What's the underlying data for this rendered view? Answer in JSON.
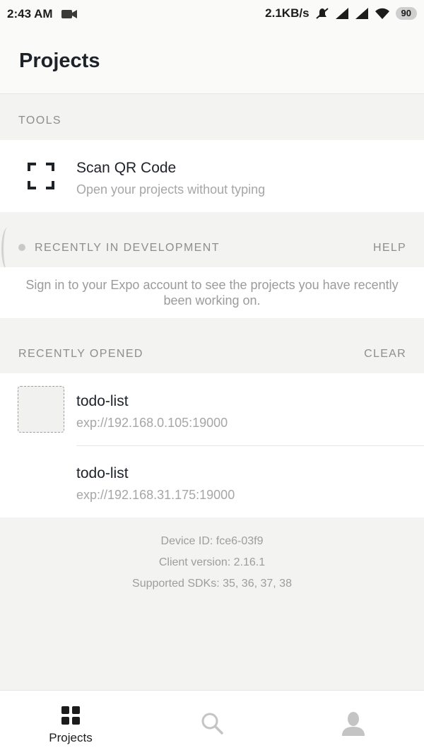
{
  "status_bar": {
    "time": "2:43 AM",
    "network_speed": "2.1KB/s",
    "battery": "90",
    "icons": [
      "video-camera-icon",
      "muted-icon",
      "signal-icon",
      "signal-icon",
      "wifi-icon",
      "battery-icon"
    ]
  },
  "header": {
    "title": "Projects"
  },
  "tools": {
    "section_label": "TOOLS",
    "scan": {
      "title": "Scan QR Code",
      "subtitle": "Open your projects without typing",
      "icon": "qr-scan-icon"
    }
  },
  "development": {
    "section_label": "RECENTLY IN DEVELOPMENT",
    "help_label": "HELP",
    "message": "Sign in to your Expo account to see the projects you have recently been working on."
  },
  "recent": {
    "section_label": "RECENTLY OPENED",
    "clear_label": "CLEAR",
    "items": [
      {
        "name": "todo-list",
        "url": "exp://192.168.0.105:19000"
      },
      {
        "name": "todo-list",
        "url": "exp://192.168.31.175:19000"
      }
    ]
  },
  "footer": {
    "device_id": "Device ID: fce6-03f9",
    "client_version": "Client version: 2.16.1",
    "supported_sdks": "Supported SDKs: 35, 36, 37, 38"
  },
  "tabbar": {
    "tabs": [
      {
        "label": "Projects",
        "icon": "projects-grid-icon",
        "active": true
      },
      {
        "label": "",
        "icon": "search-icon",
        "active": false
      },
      {
        "label": "",
        "icon": "profile-icon",
        "active": false
      }
    ]
  },
  "colors": {
    "background": "#f3f3f2",
    "card": "#ffffff",
    "text_primary": "#1e2229",
    "text_secondary": "#a6a6a6",
    "section_label": "#8e8e8e",
    "inactive_icon": "#c4c4c4"
  }
}
